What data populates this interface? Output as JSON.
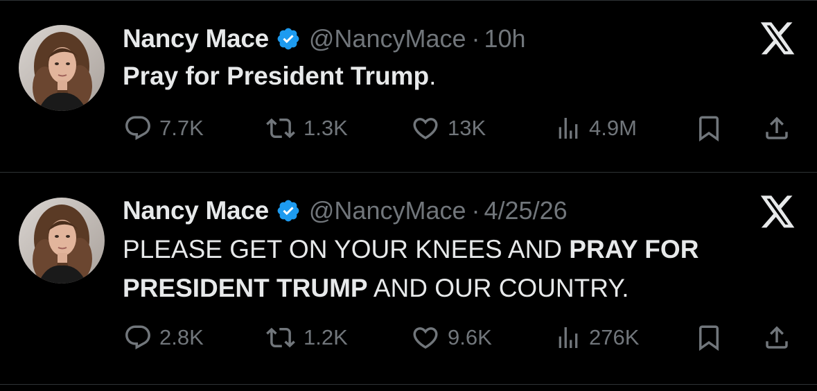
{
  "tweets": [
    {
      "author_name": "Nancy Mace",
      "handle": "@NancyMace",
      "separator": "·",
      "time": "10h",
      "text_segments": [
        {
          "text": "Pray for President Trump",
          "bold": true
        },
        {
          "text": ".",
          "bold": false
        }
      ],
      "stats": {
        "replies": "7.7K",
        "reposts": "1.3K",
        "likes": "13K",
        "views": "4.9M"
      }
    },
    {
      "author_name": "Nancy Mace",
      "handle": "@NancyMace",
      "separator": "·",
      "time": "4/25/26",
      "text_segments": [
        {
          "text": "PLEASE GET ON YOUR KNEES AND ",
          "bold": false
        },
        {
          "text": "PRAY FOR PRESIDENT TRUMP",
          "bold": true
        },
        {
          "text": " AND OUR COUNTRY.",
          "bold": false
        }
      ],
      "stats": {
        "replies": "2.8K",
        "reposts": "1.2K",
        "likes": "9.6K",
        "views": "276K"
      }
    }
  ],
  "icons": {
    "verified": "verified-badge-icon",
    "platform": "x-logo-icon",
    "reply": "reply-icon",
    "repost": "repost-icon",
    "like": "heart-icon",
    "views": "views-icon",
    "bookmark": "bookmark-icon",
    "share": "share-icon"
  },
  "colors": {
    "background": "#000000",
    "text_primary": "#e7e9ea",
    "text_secondary": "#71767b",
    "verified_blue": "#1d9bf0",
    "divider": "#2f3336"
  }
}
